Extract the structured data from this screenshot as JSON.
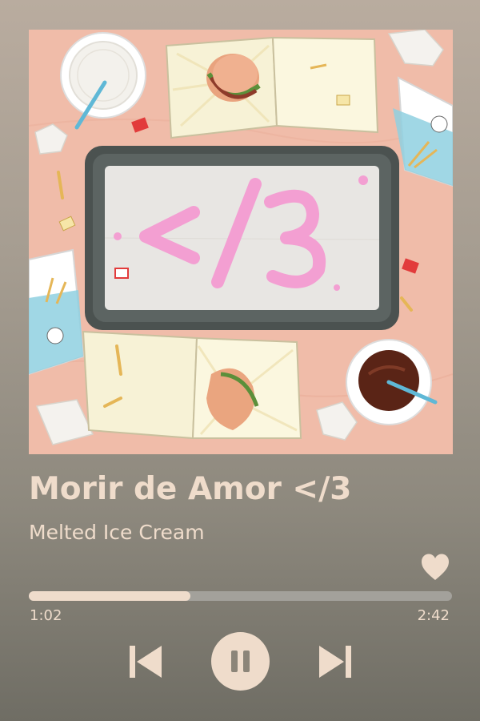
{
  "track": {
    "title": "Morir de Amor </3",
    "artist": "Melted Ice Cream",
    "liked": true
  },
  "album_art": {
    "center_text": "</3"
  },
  "progress": {
    "elapsed": "1:02",
    "total": "2:42",
    "fraction": 0.3827
  },
  "controls": {
    "previous_icon": "skip-previous-icon",
    "play_pause_icon": "pause-icon",
    "next_icon": "skip-next-icon",
    "like_icon": "heart-icon"
  },
  "colors": {
    "accent": "#efdccb",
    "track": "#a3a19b",
    "pause_glyph": "#8c8579"
  }
}
